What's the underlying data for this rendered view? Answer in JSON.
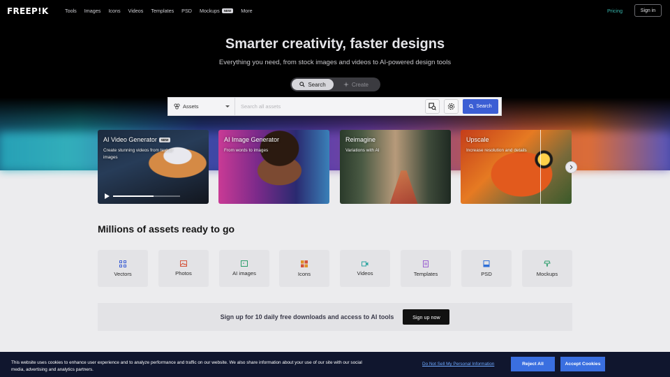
{
  "nav": {
    "logo": "FREEP!K",
    "links": [
      "Tools",
      "Images",
      "Icons",
      "Videos",
      "Templates",
      "PSD",
      "Mockups",
      "More"
    ],
    "mockups_badge": "NEW",
    "pricing": "Pricing",
    "signin": "Sign in"
  },
  "hero": {
    "headline": "Smarter creativity, faster designs",
    "subline": "Everything you need, from stock images and videos to AI-powered design tools",
    "toggle": {
      "search": "Search",
      "create": "Create"
    },
    "searchbar": {
      "category": "Assets",
      "placeholder": "Search all assets",
      "button": "Search"
    }
  },
  "cards": [
    {
      "title": "AI Video Generator",
      "badge": "NEW",
      "subtitle": "Create stunning videos from text or images"
    },
    {
      "title": "AI Image Generator",
      "subtitle": "From words to images"
    },
    {
      "title": "Reimagine",
      "subtitle": "Variations with AI"
    },
    {
      "title": "Upscale",
      "subtitle": "Increase resolution and details"
    }
  ],
  "video_progress": 0.6,
  "assets_section": {
    "title": "Millions of assets ready to go",
    "tiles": [
      {
        "label": "Vectors",
        "icon": "vectors-icon",
        "color": "#3b5ed4"
      },
      {
        "label": "Photos",
        "icon": "photos-icon",
        "color": "#d4543b"
      },
      {
        "label": "AI images",
        "icon": "ai-images-icon",
        "color": "#2a9d6a"
      },
      {
        "label": "Icons",
        "icon": "icons-icon",
        "color": "#e0912a"
      },
      {
        "label": "Videos",
        "icon": "videos-icon",
        "color": "#2aa3a0"
      },
      {
        "label": "Templates",
        "icon": "templates-icon",
        "color": "#9a5fd0"
      },
      {
        "label": "PSD",
        "icon": "psd-icon",
        "color": "#2f6fd6"
      },
      {
        "label": "Mockups",
        "icon": "mockups-icon",
        "color": "#2a9d6a"
      }
    ]
  },
  "signup": {
    "text": "Sign up for 10 daily free downloads and access to AI tools",
    "button": "Sign up now"
  },
  "cookie": {
    "text": "This website uses cookies to enhance user experience and to analyze performance and traffic on our website. We also share information about your use of our site with our social media, advertising and analytics partners.",
    "link": "Do Not Sell My Personal Information",
    "reject": "Reject All",
    "accept": "Accept Cookies"
  }
}
